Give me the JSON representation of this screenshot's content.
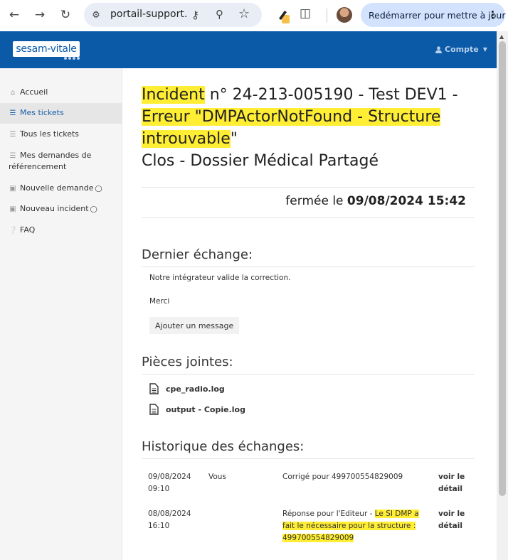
{
  "browser": {
    "url": "portail-support…",
    "update_label": "Redémarrer pour mettre à jour"
  },
  "header": {
    "logo_text": "sesam-vitale",
    "account_label": "Compte"
  },
  "sidebar": {
    "items": [
      {
        "label": "Accueil",
        "icon": "home-icon"
      },
      {
        "label": "Mes tickets",
        "icon": "list-icon"
      },
      {
        "label": "Tous les tickets",
        "icon": "list-icon"
      },
      {
        "label_line1": "Mes demandes de",
        "label_line2": "référencement",
        "icon": "list-icon"
      },
      {
        "label": "Nouvelle demande",
        "icon": "briefcase-icon"
      },
      {
        "label": "Nouveau incident",
        "icon": "briefcase-icon"
      },
      {
        "label": "FAQ",
        "icon": "question-icon"
      }
    ]
  },
  "ticket": {
    "title_word": "Incident",
    "title_rest": " n° 24-213-005190 - Test DEV1 -",
    "title_error": "Erreur \"DMPActorNotFound - Structure",
    "title_error2": "introuvable",
    "title_quote": "\"",
    "status_line": "Clos - Dossier Médical Partagé",
    "closed_prefix": "fermée le ",
    "closed_date": "09/08/2024 15:42"
  },
  "last_exchange": {
    "heading": "Dernier échange:",
    "line1": "Notre intégrateur valide la correction.",
    "line2": "Merci",
    "add_button": "Ajouter un message"
  },
  "attachments": {
    "heading": "Pièces jointes:",
    "files": [
      "cpe_radio.log",
      "output - Copie.log"
    ]
  },
  "history": {
    "heading": "Historique des échanges:",
    "rows": [
      {
        "date": "09/08/2024",
        "time": "09:10",
        "who": "Vous",
        "subject": "Corrigé pour 499700554829009",
        "link1": "voir le",
        "link2": "détail"
      },
      {
        "date": "08/08/2024",
        "time": "16:10",
        "who": "",
        "subject_plain": "Réponse pour l'Editeur - ",
        "subject_hl1": "Le SI DMP a",
        "subject_hl2": "fait le nécessaire pour la structure :",
        "subject_hl3": "499700554829009",
        "link1": "voir le",
        "link2": "détail"
      }
    ]
  },
  "colors": {
    "brand_blue": "#0a5aa8",
    "highlight": "#ffee33"
  }
}
